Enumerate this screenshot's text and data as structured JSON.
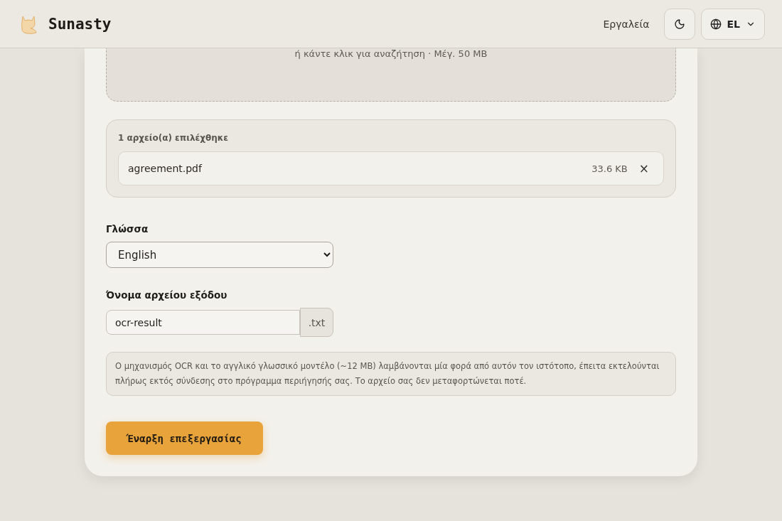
{
  "header": {
    "brand": "Sunasty",
    "nav_link": "Εργαλεία",
    "language": "EL"
  },
  "dropzone": {
    "hint": "ή κάντε κλικ για αναζήτηση · Μέγ. 50 MB"
  },
  "files": {
    "summary": "1 αρχείο(α) επιλέχθηκε",
    "items": [
      {
        "name": "agreement.pdf",
        "size": "33.6 KB",
        "remove": "×"
      }
    ]
  },
  "language": {
    "label": "Γλώσσα",
    "value": "English"
  },
  "output": {
    "label": "Όνομα αρχείου εξόδου",
    "value": "ocr-result",
    "extension": ".txt"
  },
  "notice": "Ο μηχανισμός OCR και το αγγλικό γλωσσικό μοντέλο (~12 MB) λαμβάνονται μία φορά από αυτόν τον ιστότοπο, έπειτα εκτελούνται πλήρως εκτός σύνδεσης στο πρόγραμμα περιήγησής σας. Το αρχείο σας δεν μεταφορτώνεται ποτέ.",
  "start_button": "Έναρξη επεξεργασίας"
}
